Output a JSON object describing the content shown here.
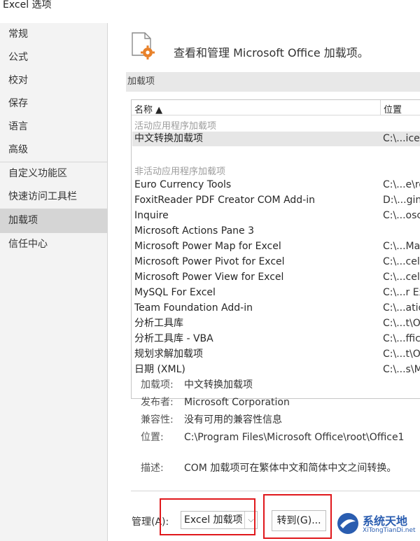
{
  "window": {
    "title": "Excel 选项"
  },
  "sidebar": {
    "items": [
      {
        "label": "常规"
      },
      {
        "label": "公式"
      },
      {
        "label": "校对"
      },
      {
        "label": "保存"
      },
      {
        "label": "语言"
      },
      {
        "label": "高级"
      },
      {
        "label": "自定义功能区"
      },
      {
        "label": "快速访问工具栏"
      },
      {
        "label": "加载项",
        "active": true
      },
      {
        "label": "信任中心"
      }
    ]
  },
  "header": {
    "text": "查看和管理 Microsoft Office 加载项。",
    "icon": "document-gear-icon"
  },
  "section": {
    "title": "加载项"
  },
  "table": {
    "columns": {
      "name": "名称 ▲",
      "location": "位置"
    },
    "active_group": "活动应用程序加载项",
    "inactive_group": "非活动应用程序加载项",
    "active_rows": [
      {
        "name": "中文转换加载项",
        "location": "C:\\...ice\\"
      }
    ],
    "inactive_rows": [
      {
        "name": "Euro Currency Tools",
        "location": "C:\\...e\\ro"
      },
      {
        "name": "FoxitReader PDF Creator COM Add-in",
        "location": "D:\\...gin"
      },
      {
        "name": "Inquire",
        "location": "C:\\...osc"
      },
      {
        "name": "Microsoft Actions Pane 3",
        "location": ""
      },
      {
        "name": "Microsoft Power Map for Excel",
        "location": "C:\\...Ma"
      },
      {
        "name": "Microsoft Power Pivot for Excel",
        "location": "C:\\...cel"
      },
      {
        "name": "Microsoft Power View for Excel",
        "location": "C:\\...cel"
      },
      {
        "name": "MySQL For Excel",
        "location": "C:\\...r Ex"
      },
      {
        "name": "Team Foundation Add-in",
        "location": "C:\\...atio"
      },
      {
        "name": "分析工具库",
        "location": "C:\\...t\\O"
      },
      {
        "name": "分析工具库 - VBA",
        "location": "C:\\...ffic"
      },
      {
        "name": "规划求解加载项",
        "location": "C:\\...t\\O"
      },
      {
        "name": "日期 (XML)",
        "location": "C:\\...s\\M"
      }
    ]
  },
  "details": {
    "addin_label": "加载项:",
    "addin_value": "中文转换加载项",
    "publisher_label": "发布者:",
    "publisher_value": "Microsoft Corporation",
    "compat_label": "兼容性:",
    "compat_value": "没有可用的兼容性信息",
    "location_label": "位置:",
    "location_value": "C:\\Program Files\\Microsoft Office\\root\\Office1",
    "desc_label": "描述:",
    "desc_value": "COM 加载项可在繁体中文和简体中文之间转换。"
  },
  "footer": {
    "manage_label": "管理(A):",
    "manage_value": "Excel 加载项",
    "goto_label": "转到(G)..."
  },
  "watermark": {
    "line1": "系统天地",
    "line2": "XiTongTianDi.net"
  },
  "colors": {
    "highlight_box": "#e0181c",
    "sidebar_bg": "#f3f3f3",
    "selected_row": "#e6e6e6"
  }
}
